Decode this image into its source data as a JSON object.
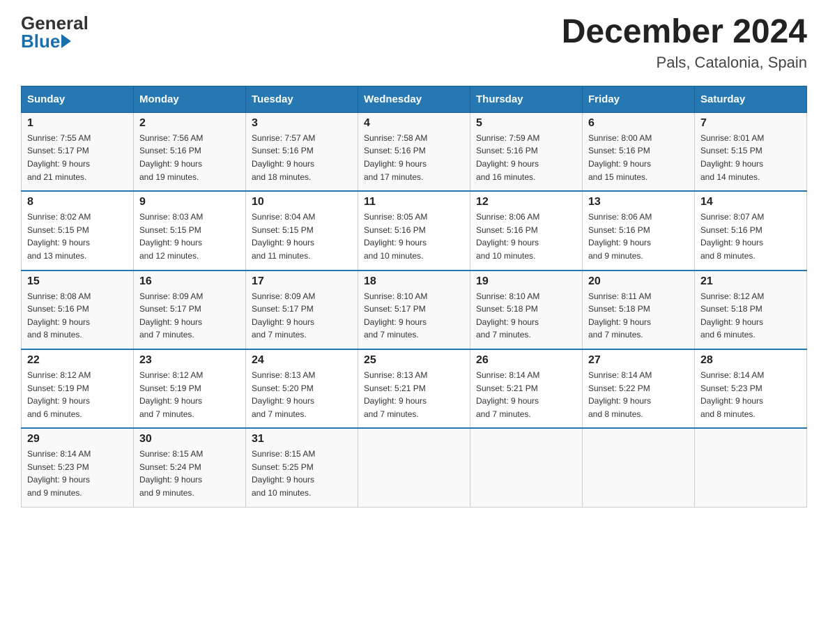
{
  "logo": {
    "general": "General",
    "blue": "Blue"
  },
  "header": {
    "title": "December 2024",
    "subtitle": "Pals, Catalonia, Spain"
  },
  "weekdays": [
    "Sunday",
    "Monday",
    "Tuesday",
    "Wednesday",
    "Thursday",
    "Friday",
    "Saturday"
  ],
  "weeks": [
    [
      {
        "day": "1",
        "sunrise": "7:55 AM",
        "sunset": "5:17 PM",
        "daylight": "9 hours and 21 minutes."
      },
      {
        "day": "2",
        "sunrise": "7:56 AM",
        "sunset": "5:16 PM",
        "daylight": "9 hours and 19 minutes."
      },
      {
        "day": "3",
        "sunrise": "7:57 AM",
        "sunset": "5:16 PM",
        "daylight": "9 hours and 18 minutes."
      },
      {
        "day": "4",
        "sunrise": "7:58 AM",
        "sunset": "5:16 PM",
        "daylight": "9 hours and 17 minutes."
      },
      {
        "day": "5",
        "sunrise": "7:59 AM",
        "sunset": "5:16 PM",
        "daylight": "9 hours and 16 minutes."
      },
      {
        "day": "6",
        "sunrise": "8:00 AM",
        "sunset": "5:16 PM",
        "daylight": "9 hours and 15 minutes."
      },
      {
        "day": "7",
        "sunrise": "8:01 AM",
        "sunset": "5:15 PM",
        "daylight": "9 hours and 14 minutes."
      }
    ],
    [
      {
        "day": "8",
        "sunrise": "8:02 AM",
        "sunset": "5:15 PM",
        "daylight": "9 hours and 13 minutes."
      },
      {
        "day": "9",
        "sunrise": "8:03 AM",
        "sunset": "5:15 PM",
        "daylight": "9 hours and 12 minutes."
      },
      {
        "day": "10",
        "sunrise": "8:04 AM",
        "sunset": "5:15 PM",
        "daylight": "9 hours and 11 minutes."
      },
      {
        "day": "11",
        "sunrise": "8:05 AM",
        "sunset": "5:16 PM",
        "daylight": "9 hours and 10 minutes."
      },
      {
        "day": "12",
        "sunrise": "8:06 AM",
        "sunset": "5:16 PM",
        "daylight": "9 hours and 10 minutes."
      },
      {
        "day": "13",
        "sunrise": "8:06 AM",
        "sunset": "5:16 PM",
        "daylight": "9 hours and 9 minutes."
      },
      {
        "day": "14",
        "sunrise": "8:07 AM",
        "sunset": "5:16 PM",
        "daylight": "9 hours and 8 minutes."
      }
    ],
    [
      {
        "day": "15",
        "sunrise": "8:08 AM",
        "sunset": "5:16 PM",
        "daylight": "9 hours and 8 minutes."
      },
      {
        "day": "16",
        "sunrise": "8:09 AM",
        "sunset": "5:17 PM",
        "daylight": "9 hours and 7 minutes."
      },
      {
        "day": "17",
        "sunrise": "8:09 AM",
        "sunset": "5:17 PM",
        "daylight": "9 hours and 7 minutes."
      },
      {
        "day": "18",
        "sunrise": "8:10 AM",
        "sunset": "5:17 PM",
        "daylight": "9 hours and 7 minutes."
      },
      {
        "day": "19",
        "sunrise": "8:10 AM",
        "sunset": "5:18 PM",
        "daylight": "9 hours and 7 minutes."
      },
      {
        "day": "20",
        "sunrise": "8:11 AM",
        "sunset": "5:18 PM",
        "daylight": "9 hours and 7 minutes."
      },
      {
        "day": "21",
        "sunrise": "8:12 AM",
        "sunset": "5:18 PM",
        "daylight": "9 hours and 6 minutes."
      }
    ],
    [
      {
        "day": "22",
        "sunrise": "8:12 AM",
        "sunset": "5:19 PM",
        "daylight": "9 hours and 6 minutes."
      },
      {
        "day": "23",
        "sunrise": "8:12 AM",
        "sunset": "5:19 PM",
        "daylight": "9 hours and 7 minutes."
      },
      {
        "day": "24",
        "sunrise": "8:13 AM",
        "sunset": "5:20 PM",
        "daylight": "9 hours and 7 minutes."
      },
      {
        "day": "25",
        "sunrise": "8:13 AM",
        "sunset": "5:21 PM",
        "daylight": "9 hours and 7 minutes."
      },
      {
        "day": "26",
        "sunrise": "8:14 AM",
        "sunset": "5:21 PM",
        "daylight": "9 hours and 7 minutes."
      },
      {
        "day": "27",
        "sunrise": "8:14 AM",
        "sunset": "5:22 PM",
        "daylight": "9 hours and 8 minutes."
      },
      {
        "day": "28",
        "sunrise": "8:14 AM",
        "sunset": "5:23 PM",
        "daylight": "9 hours and 8 minutes."
      }
    ],
    [
      {
        "day": "29",
        "sunrise": "8:14 AM",
        "sunset": "5:23 PM",
        "daylight": "9 hours and 9 minutes."
      },
      {
        "day": "30",
        "sunrise": "8:15 AM",
        "sunset": "5:24 PM",
        "daylight": "9 hours and 9 minutes."
      },
      {
        "day": "31",
        "sunrise": "8:15 AM",
        "sunset": "5:25 PM",
        "daylight": "9 hours and 10 minutes."
      },
      null,
      null,
      null,
      null
    ]
  ],
  "labels": {
    "sunrise": "Sunrise:",
    "sunset": "Sunset:",
    "daylight": "Daylight:"
  }
}
